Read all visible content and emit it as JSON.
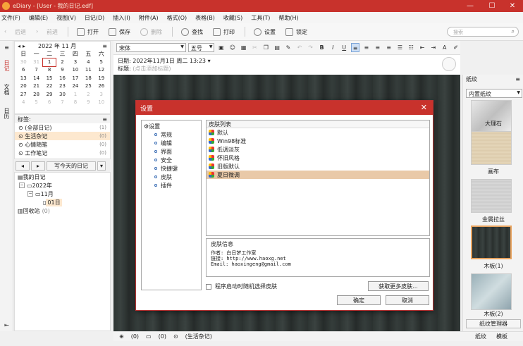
{
  "window": {
    "title": "eDiary - [User - 我的日记.edf]",
    "controls": [
      "—",
      "☐",
      "✕"
    ]
  },
  "menu": [
    "文件(F)",
    "编辑(E)",
    "视图(V)",
    "日记(D)",
    "插入(I)",
    "附件(A)",
    "格式(O)",
    "表格(B)",
    "收藏(S)",
    "工具(T)",
    "帮助(H)"
  ],
  "toolbar": {
    "back": "后退",
    "forward": "前进",
    "open": "打开",
    "save": "保存",
    "delete": "删除",
    "find": "查找",
    "print": "打印",
    "settings": "设置",
    "lock": "锁定",
    "search_placeholder": "搜索"
  },
  "sidebar_tabs": [
    "日记",
    "文档",
    "日历"
  ],
  "calendar": {
    "header": "2022 年 11 月",
    "weekdays": [
      "日",
      "一",
      "二",
      "三",
      "四",
      "五",
      "六"
    ],
    "days": [
      [
        "30",
        "31",
        "1",
        "2",
        "3",
        "4",
        "5"
      ],
      [
        "6",
        "7",
        "8",
        "9",
        "10",
        "11",
        "12"
      ],
      [
        "13",
        "14",
        "15",
        "16",
        "17",
        "18",
        "19"
      ],
      [
        "20",
        "21",
        "22",
        "23",
        "24",
        "25",
        "26"
      ],
      [
        "27",
        "28",
        "29",
        "30",
        "1",
        "2",
        "3"
      ],
      [
        "4",
        "5",
        "6",
        "7",
        "8",
        "9",
        "10"
      ]
    ]
  },
  "tags": {
    "title": "标签:",
    "items": [
      {
        "label": "(全部日记)",
        "count": "(1)"
      },
      {
        "label": "生活杂记",
        "count": "(0)"
      },
      {
        "label": "心情随笔",
        "count": "(0)"
      },
      {
        "label": "工作笔记",
        "count": "(0)"
      }
    ]
  },
  "today_button": "写今天的日记",
  "tree": {
    "root": "我的日记",
    "year": "2022年",
    "month": "11月",
    "day": "01日",
    "trash": "回收站",
    "trash_count": "(0)"
  },
  "editor": {
    "font": "宋体",
    "size": "五号",
    "date_label": "日期:",
    "date_value": "2022年11月1日 周二 13:23",
    "title_label": "标题:",
    "title_placeholder": "(点击添加标题)"
  },
  "dialog": {
    "title": "设置",
    "nav_root": "设置",
    "nav_items": [
      "常规",
      "编辑",
      "界面",
      "安全",
      "快捷键",
      "皮肤",
      "插件"
    ],
    "skin_list_header": "皮肤列表",
    "skins": [
      "默认",
      "Win98标准",
      "低调淡灰",
      "怀旧风格",
      "旧版默认",
      "夏日微调"
    ],
    "selected_skin": "夏日微调",
    "info_header": "皮肤信息",
    "info_author": "作者: 白日梦工作室",
    "info_link": "链接: http://www.haoxg.net",
    "info_email": "Email: haoxingeng@gmail.com",
    "random_checkbox": "程序启动时随机选择皮肤",
    "more_button": "获取更多皮肤...",
    "ok": "确定",
    "cancel": "取消"
  },
  "right_panel": {
    "title": "纸纹",
    "dropdown": "内置纸纹",
    "thumbs": [
      "大理石",
      "画布",
      "金属拉丝",
      "木板(1)",
      "木板(2)"
    ],
    "selected": "木板(1)",
    "manager_button": "纸纹管理器",
    "bottom_tabs": [
      "纸纹",
      "模板"
    ]
  },
  "status": {
    "attach": "(0)",
    "comment": "(0)",
    "tag": "(生活杂记)"
  }
}
